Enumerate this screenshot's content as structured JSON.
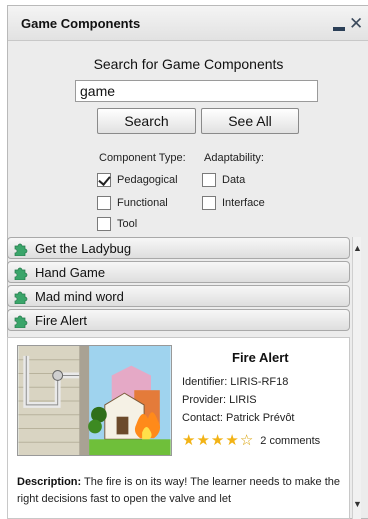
{
  "window": {
    "title": "Game Components",
    "minimize_icon": "minimize-icon",
    "close_icon": "close-icon"
  },
  "search": {
    "heading": "Search for Game Components",
    "value": "game",
    "placeholder": "",
    "search_button": "Search",
    "see_all_button": "See All"
  },
  "filters": {
    "component_type_label": "Component Type:",
    "adaptability_label": "Adaptability:",
    "component_types": [
      {
        "label": "Pedagogical",
        "checked": true
      },
      {
        "label": "Functional",
        "checked": false
      },
      {
        "label": "Tool",
        "checked": false
      }
    ],
    "adaptability": [
      {
        "label": "Data",
        "checked": false
      },
      {
        "label": "Interface",
        "checked": false
      }
    ]
  },
  "results": [
    {
      "label": "Get the Ladybug",
      "icon": "puzzle-piece-icon"
    },
    {
      "label": "Hand Game",
      "icon": "puzzle-piece-icon"
    },
    {
      "label": "Mad mind word",
      "icon": "puzzle-piece-icon"
    },
    {
      "label": "Fire Alert",
      "icon": "puzzle-piece-icon"
    }
  ],
  "detail": {
    "title": "Fire Alert",
    "identifier": "Identifier: LIRIS-RF18",
    "provider": "Provider: LIRIS",
    "contact": "Contact: Patrick Prévôt",
    "rating": 4,
    "rating_max": 5,
    "comments": "2 comments",
    "description_label": "Description:",
    "description_text": " The fire is on its way! The learner needs to make the right decisions fast to open the valve and let"
  },
  "colors": {
    "puzzle_green": "#3aa56a",
    "star_gold": "#f2b316"
  }
}
